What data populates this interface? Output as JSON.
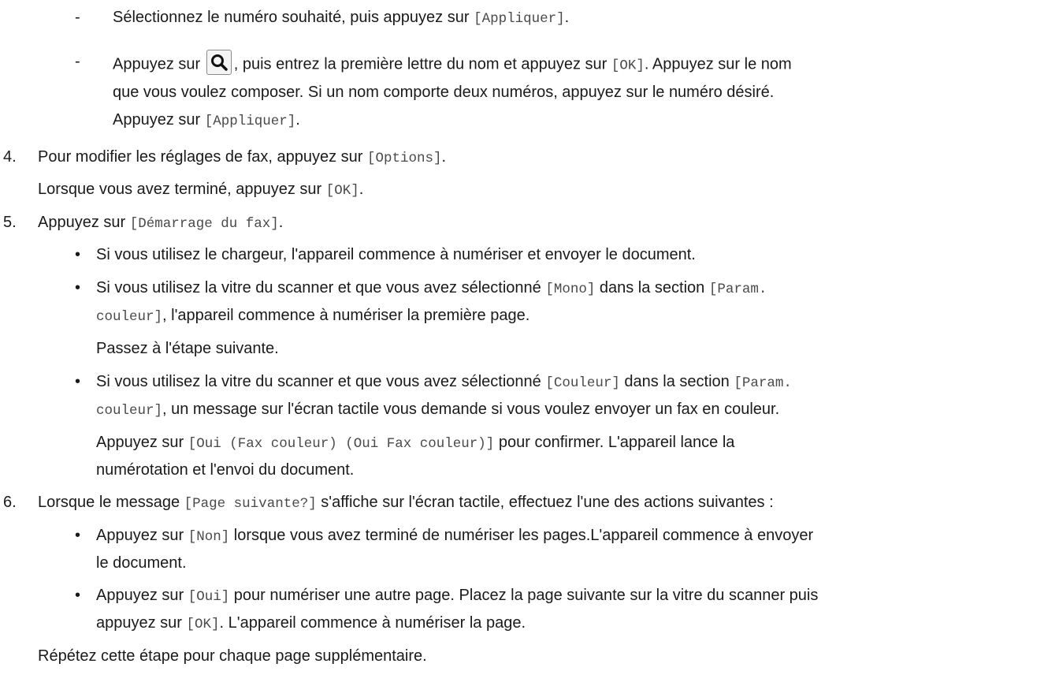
{
  "s3a": {
    "dash": "-",
    "t1": "Sélectionnez le numéro souhaité, puis appuyez sur ",
    "m1": "[Appliquer]",
    "t2": "."
  },
  "s3b": {
    "dash": "-",
    "t1": "Appuyez sur",
    "t2": ", puis entrez la première lettre du nom et appuyez sur ",
    "m1": "[OK]",
    "t3": ". Appuyez sur le nom",
    "l2": "que vous voulez composer. Si un nom comporte deux numéros, appuyez sur le numéro désiré.",
    "l3": "Appuyez sur ",
    "m2": "[Appliquer]",
    "t4": "."
  },
  "s4": {
    "num": "4.",
    "t1": "Pour modifier les réglages de fax, appuyez sur ",
    "m1": "[Options]",
    "t2": ".",
    "t3": "Lorsque vous avez terminé, appuyez sur ",
    "m2": "[OK]",
    "t4": "."
  },
  "s5": {
    "num": "5.",
    "t1": "Appuyez sur ",
    "m1": "[Démarrage du fax]",
    "t2": ".",
    "b1": {
      "bullet": "•",
      "text": "Si vous utilisez le chargeur, l'appareil commence à numériser et envoyer le document."
    },
    "b2": {
      "bullet": "•",
      "t1": "Si vous utilisez la vitre du scanner et que vous avez sélectionné ",
      "m1": "[Mono]",
      "t2": " dans la section ",
      "m2": "[Param.",
      "m3": "couleur]",
      "t3": ", l'appareil commence à numériser la première page.",
      "t4": "Passez à l'étape suivante."
    },
    "b3": {
      "bullet": "•",
      "t1": "Si vous utilisez la vitre du scanner et que vous avez sélectionné ",
      "m1": "[Couleur]",
      "t2": " dans la section ",
      "m2": "[Param.",
      "m3": "couleur]",
      "t3": ", un message sur l'écran tactile vous demande si vous voulez envoyer un fax en couleur.",
      "t4": "Appuyez sur ",
      "m4": "[Oui (Fax couleur) (Oui Fax couleur)]",
      "t5": " pour confirmer. L'appareil lance la",
      "t6": "numérotation et l'envoi du document."
    }
  },
  "s6": {
    "num": "6.",
    "t1": "Lorsque le message ",
    "m1": "[Page suivante?]",
    "t2": " s'affiche sur l'écran tactile, effectuez l'une des actions suivantes :",
    "b1": {
      "bullet": "•",
      "t1": "Appuyez sur ",
      "m1": "[Non]",
      "t2": " lorsque vous avez terminé de numériser les pages.L'appareil commence à envoyer",
      "t3": "le document."
    },
    "b2": {
      "bullet": "•",
      "t1": "Appuyez sur ",
      "m1": "[Oui]",
      "t2": " pour numériser une autre page. Placez la page suivante sur la vitre du scanner puis",
      "t3": "appuyez sur ",
      "m2": "[OK]",
      "t4": ". L'appareil commence à numériser la page."
    },
    "footer": "Répétez cette étape pour chaque page supplémentaire."
  },
  "icons": {
    "search_button": "magnifier-icon"
  }
}
